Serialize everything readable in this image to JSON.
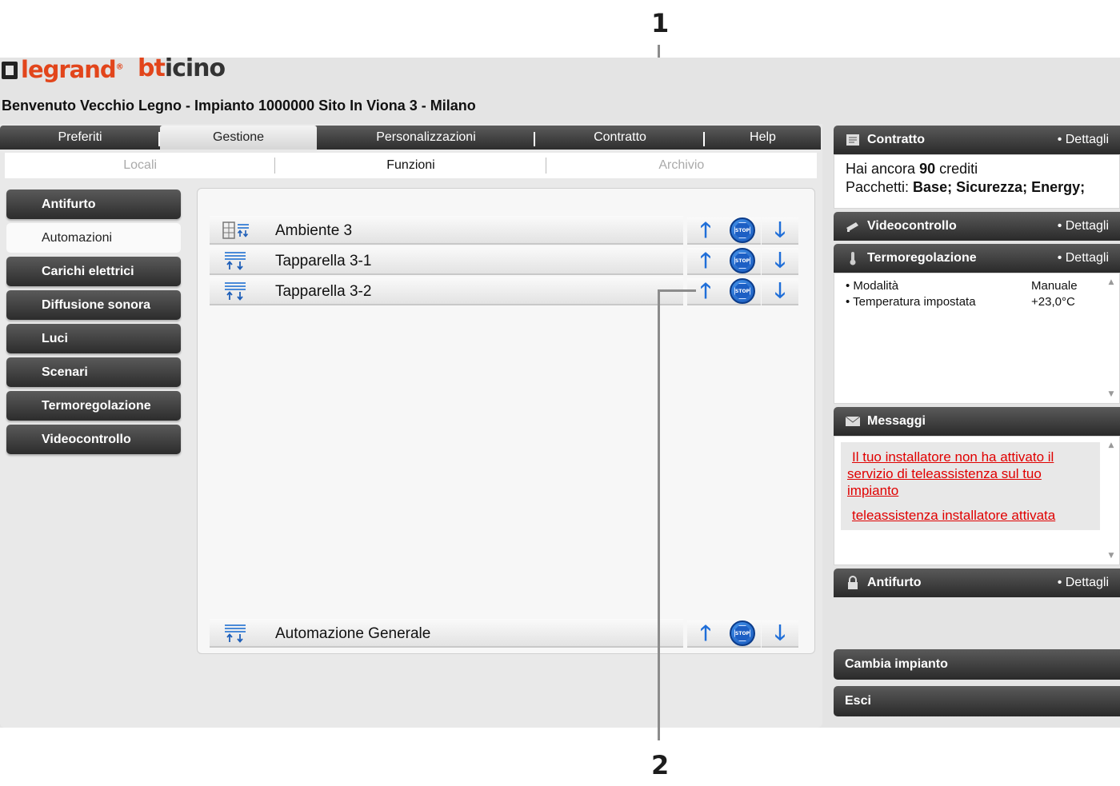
{
  "callouts": {
    "one": "1",
    "two": "2"
  },
  "brand": {
    "legrand": "legrand",
    "legrand_reg": "®",
    "bticino_b": "bt",
    "bticino_rest": "icino"
  },
  "welcome": "Benvenuto Vecchio Legno - Impianto 1000000 Sito In Viona 3 - Milano",
  "tabs": [
    {
      "label": "Preferiti"
    },
    {
      "label": "Gestione"
    },
    {
      "label": "Personalizzazioni"
    },
    {
      "label": "Contratto"
    },
    {
      "label": "Help"
    }
  ],
  "subtabs": [
    {
      "label": "Locali"
    },
    {
      "label": "Funzioni"
    },
    {
      "label": "Archivio"
    }
  ],
  "sidebar": {
    "items": [
      {
        "label": "Antifurto"
      },
      {
        "label": "Automazioni"
      },
      {
        "label": "Carichi elettrici"
      },
      {
        "label": "Diffusione sonora"
      },
      {
        "label": "Luci"
      },
      {
        "label": "Scenari"
      },
      {
        "label": "Termoregolazione"
      },
      {
        "label": "Videocontrollo"
      }
    ]
  },
  "automations": {
    "rows": [
      {
        "label": "Ambiente 3",
        "icon": "room-shutter-icon"
      },
      {
        "label": "Tapparella 3-1",
        "icon": "shutter-icon"
      },
      {
        "label": "Tapparella 3-2",
        "icon": "shutter-icon"
      }
    ],
    "general": {
      "label": "Automazione Generale",
      "icon": "shutter-icon"
    },
    "stop_text": "STOP",
    "up_glyph": "🡑",
    "down_glyph": "🡓"
  },
  "right": {
    "details_label": "Dettagli",
    "contratto": {
      "title": "Contratto",
      "line1_pre": "Hai ancora ",
      "line1_num": "90",
      "line1_post": " crediti",
      "line2_pre": "Pacchetti: ",
      "line2_bold": "Base; Sicurezza; Energy;"
    },
    "videocontrollo": {
      "title": "Videocontrollo"
    },
    "termoregolazione": {
      "title": "Termoregolazione",
      "rows": [
        {
          "label": "• Modalità",
          "value": "Manuale"
        },
        {
          "label": "• Temperatura impostata",
          "value": "+23,0°C"
        }
      ]
    },
    "messaggi": {
      "title": "Messaggi",
      "msg1": "Il tuo installatore non ha attivato il servizio di teleassistenza sul tuo impianto",
      "msg2": "teleassistenza installatore attivata"
    },
    "antifurto": {
      "title": "Antifurto"
    },
    "cambia": "Cambia impianto",
    "esci": "Esci"
  }
}
